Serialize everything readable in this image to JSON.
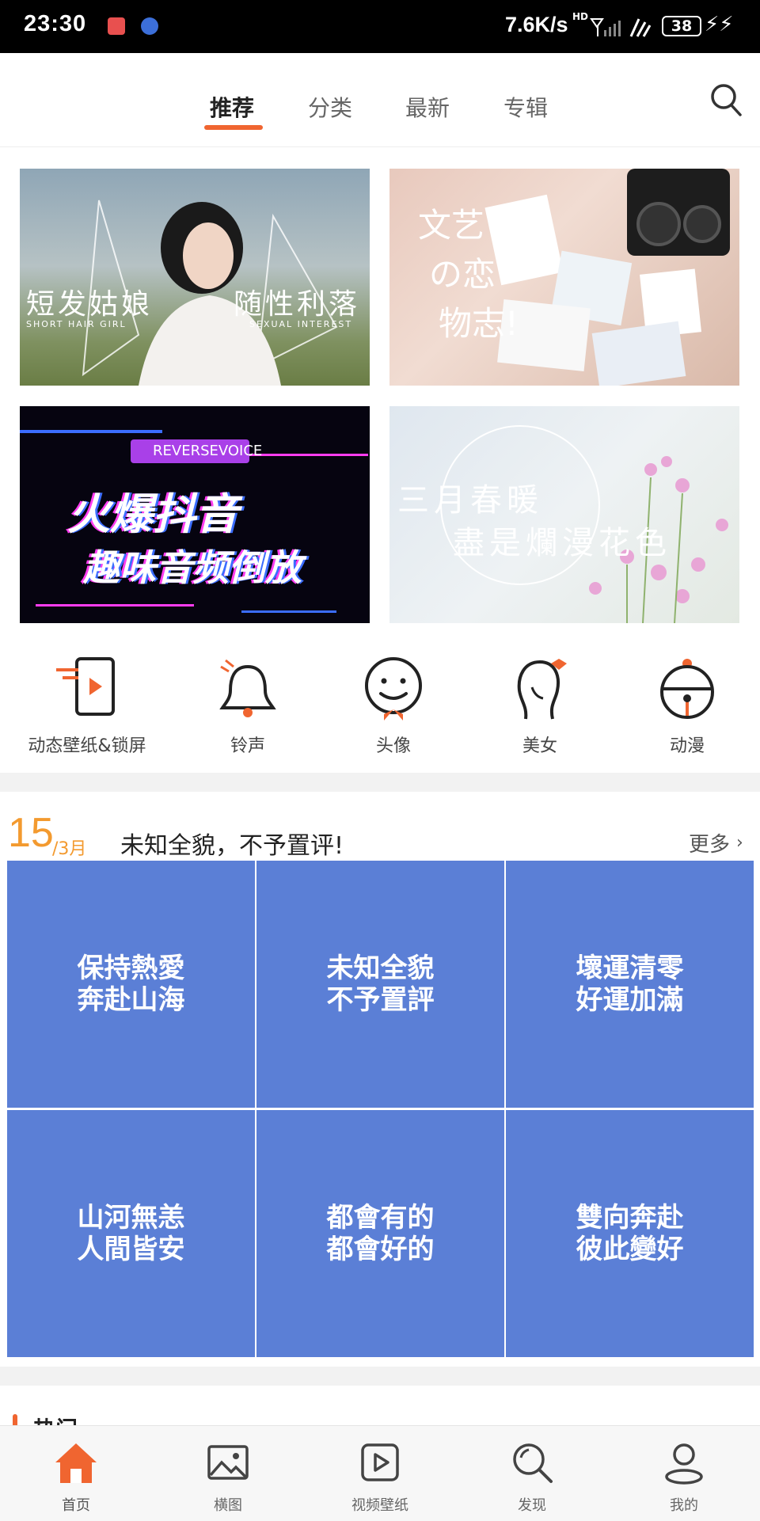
{
  "status_bar": {
    "time": "23:30",
    "network_speed": "7.6K/s",
    "hd": "HD",
    "battery": "38"
  },
  "tabs": [
    {
      "label": "推荐",
      "active": true
    },
    {
      "label": "分类",
      "active": false
    },
    {
      "label": "最新",
      "active": false
    },
    {
      "label": "专辑",
      "active": false
    }
  ],
  "banners": [
    {
      "title": "短发姑娘",
      "title2": "随性利落",
      "sub": "SHORT HAIR GIRL",
      "sub2": "SEXUAL INTEREST"
    },
    {
      "title": "文艺",
      "title2": "の恋",
      "title3": "物志!"
    },
    {
      "badge": "REVERSEVOICE",
      "title": "火爆抖音",
      "title2": "趣味音频倒放"
    },
    {
      "title": "三月春暖",
      "title2": "盡是爛漫花色"
    }
  ],
  "categories": [
    {
      "label": "动态壁纸&锁屏",
      "icon": "live-wallpaper-icon"
    },
    {
      "label": "铃声",
      "icon": "bell-icon"
    },
    {
      "label": "头像",
      "icon": "avatar-face-icon"
    },
    {
      "label": "美女",
      "icon": "girl-icon"
    },
    {
      "label": "动漫",
      "icon": "anime-bell-icon"
    }
  ],
  "daily": {
    "day": "15",
    "month": "/3月",
    "subject": "未知全貌，不予置评!",
    "more": "更多"
  },
  "tiles": [
    {
      "text": "保持熱愛\n奔赴山海"
    },
    {
      "text": "未知全貌\n不予置評"
    },
    {
      "text": "壞運清零\n好運加滿"
    },
    {
      "text": "山河無恙\n人間皆安"
    },
    {
      "text": "都會有的\n都會好的"
    },
    {
      "text": "雙向奔赴\n彼此變好"
    }
  ],
  "hot_label": "热门",
  "bottom_nav": [
    {
      "label": "首页",
      "icon": "home-icon",
      "active": true
    },
    {
      "label": "横图",
      "icon": "image-icon",
      "active": false
    },
    {
      "label": "视频壁纸",
      "icon": "video-wallpaper-icon",
      "active": false
    },
    {
      "label": "发现",
      "icon": "discover-icon",
      "active": false
    },
    {
      "label": "我的",
      "icon": "profile-icon",
      "active": false
    }
  ],
  "colors": {
    "accent": "#f06530",
    "tile_blue": "#5b7fd6",
    "date_orange": "#f39a2f"
  }
}
